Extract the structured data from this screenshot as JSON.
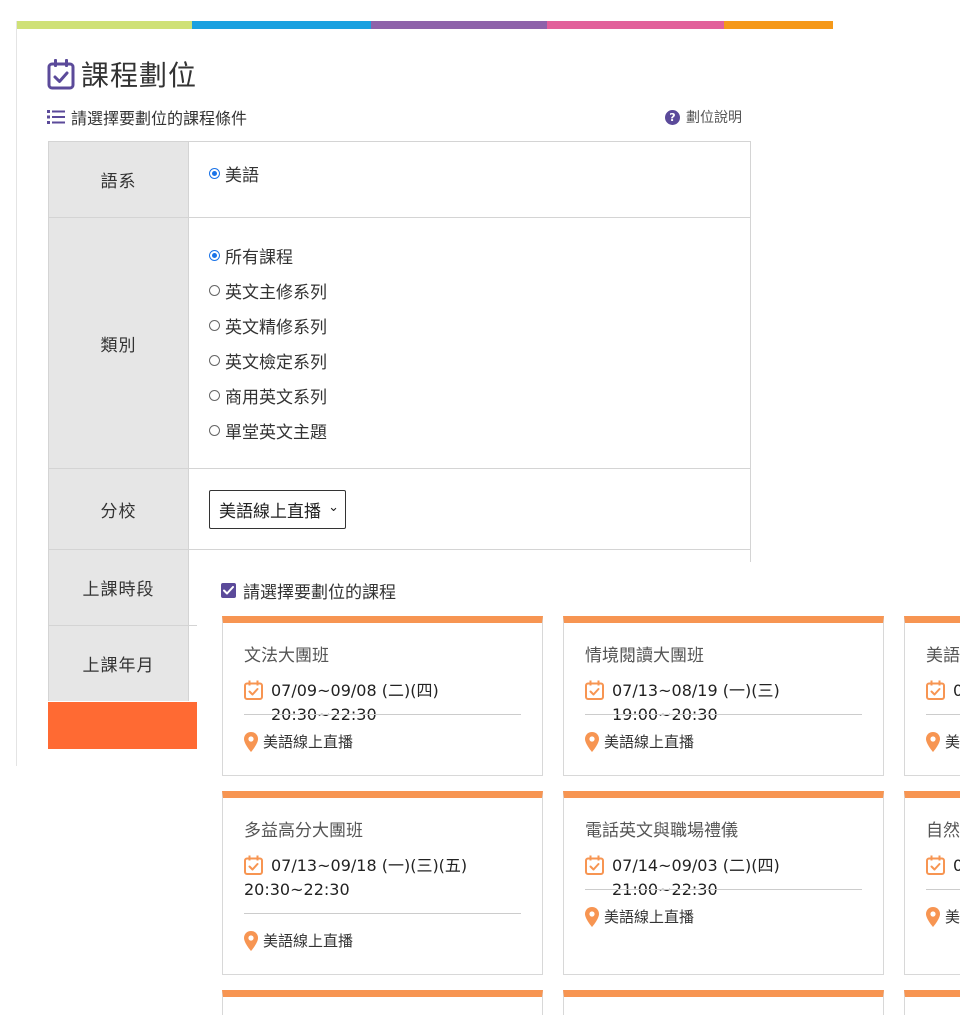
{
  "brand_colors": [
    "#cfe177",
    "#1aa1e0",
    "#8e62aa",
    "#e2609a",
    "#f5991a"
  ],
  "header": {
    "title": "課程劃位",
    "subtitle": "請選擇要劃位的課程條件",
    "help_link": "劃位說明"
  },
  "form": {
    "language": {
      "label": "語系",
      "options": [
        {
          "label": "美語",
          "selected": true
        }
      ]
    },
    "category": {
      "label": "類別",
      "options": [
        {
          "label": "所有課程",
          "selected": true
        },
        {
          "label": "英文主修系列",
          "selected": false
        },
        {
          "label": "英文精修系列",
          "selected": false
        },
        {
          "label": "英文檢定系列",
          "selected": false
        },
        {
          "label": "商用英文系列",
          "selected": false
        },
        {
          "label": "單堂英文主題",
          "selected": false
        }
      ]
    },
    "branch": {
      "label": "分校",
      "selected_value": "美語線上直播"
    },
    "time_slot": {
      "label": "上課時段"
    },
    "month": {
      "label": "上課年月"
    }
  },
  "courses_section": {
    "header": "請選擇要劃位的課程",
    "accent_color": "#f79552",
    "cards": [
      {
        "title": "文法大團班",
        "schedule_line1": "07/09~09/08  (二)(四) 20:30~22:30",
        "schedule_line2": "",
        "location": "美語線上直播"
      },
      {
        "title": "情境閱讀大團班",
        "schedule_line1": "07/13~08/19  (一)(三) 19:00~20:30",
        "schedule_line2": "",
        "location": "美語線上直播"
      },
      {
        "title": "美語",
        "schedule_line1": "0",
        "schedule_line2": "",
        "location": "美"
      },
      {
        "title": "多益高分大團班",
        "schedule_line1": "07/13~09/18  (一)(三)(五)",
        "schedule_line2": "20:30~22:30",
        "location": "美語線上直播"
      },
      {
        "title": "電話英文與職場禮儀",
        "schedule_line1": "07/14~09/03  (二)(四) 21:00~22:30",
        "schedule_line2": "",
        "location": "美語線上直播"
      },
      {
        "title": "自然",
        "schedule_line1": "0",
        "schedule_line2": "",
        "location": "美"
      }
    ]
  }
}
